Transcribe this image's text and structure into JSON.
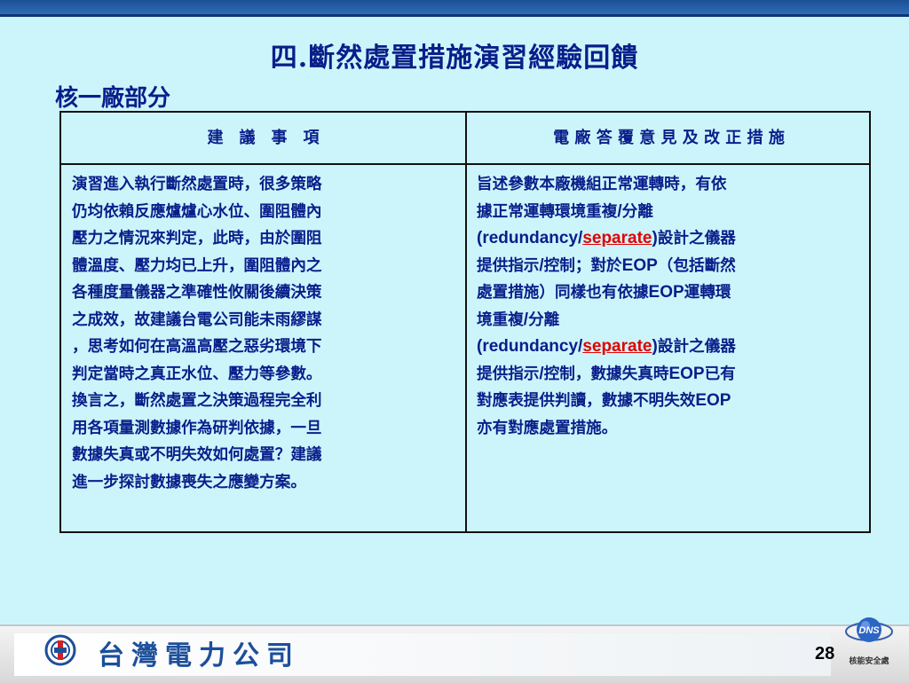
{
  "slide": {
    "title": "四.斷然處置措施演習經驗回饋",
    "section": "核一廠部分"
  },
  "table": {
    "headers": [
      "建　議　事　項",
      "電 廠 答 覆 意 見 及 改 正 措 施"
    ],
    "left_lines": [
      "演習進入執行斷然處置時，很多策略",
      "仍均依賴反應爐爐心水位、圍阻體內",
      "壓力之情況來判定，此時，由於圍阻",
      "體溫度、壓力均已上升，圍阻體內之",
      "各種度量儀器之準確性攸關後續決策",
      "之成效，故建議台電公司能未雨繆謀",
      "，思考如何在高溫高壓之惡劣環境下",
      "判定當時之真正水位、壓力等參數。",
      "換言之，斷然處置之決策過程完全利",
      "用各項量測數據作為研判依據，一旦",
      "數據失真或不明失效如何處置？建議",
      "進一步探討數據喪失之應變方案。"
    ],
    "right": {
      "l1": "旨述參數本廠機組正常運轉時，有依",
      "l2a": "據正常運轉環境重複",
      "l2b": "/",
      "l2c": "分離",
      "l3a": "(redundancy/",
      "l3b": "separate",
      "l3c": ")",
      "l3d": "設計之儀器",
      "l4a": "提供指示",
      "l4b": "/",
      "l4c": "控制；對於",
      "l4d": "EOP",
      "l4e": "（包括斷然",
      "l5a": "處置措施）同樣也有依據",
      "l5b": "EOP",
      "l5c": "運轉環",
      "l6a": "境重複",
      "l6b": "/",
      "l6c": "分離",
      "l7a": "(redundancy/",
      "l7b": "separate",
      "l7c": ")",
      "l7d": "設計之儀器",
      "l8a": "提供指示",
      "l8b": "/",
      "l8c": "控制，數據失真時",
      "l8d": "EOP",
      "l8e": "已有",
      "l9a": "對應表提供判讀，數據不明失效",
      "l9b": "EOP",
      "l10": "亦有對應處置措施。"
    }
  },
  "footer": {
    "company": "台灣電力公司",
    "page_number": "28",
    "badge_logo_text": "DNS",
    "badge_caption": "核能安全處"
  },
  "colors": {
    "background": "#ccf5fb",
    "text": "#0a1e8a",
    "highlight": "#e00000",
    "top_bar": "#2c6db5"
  }
}
